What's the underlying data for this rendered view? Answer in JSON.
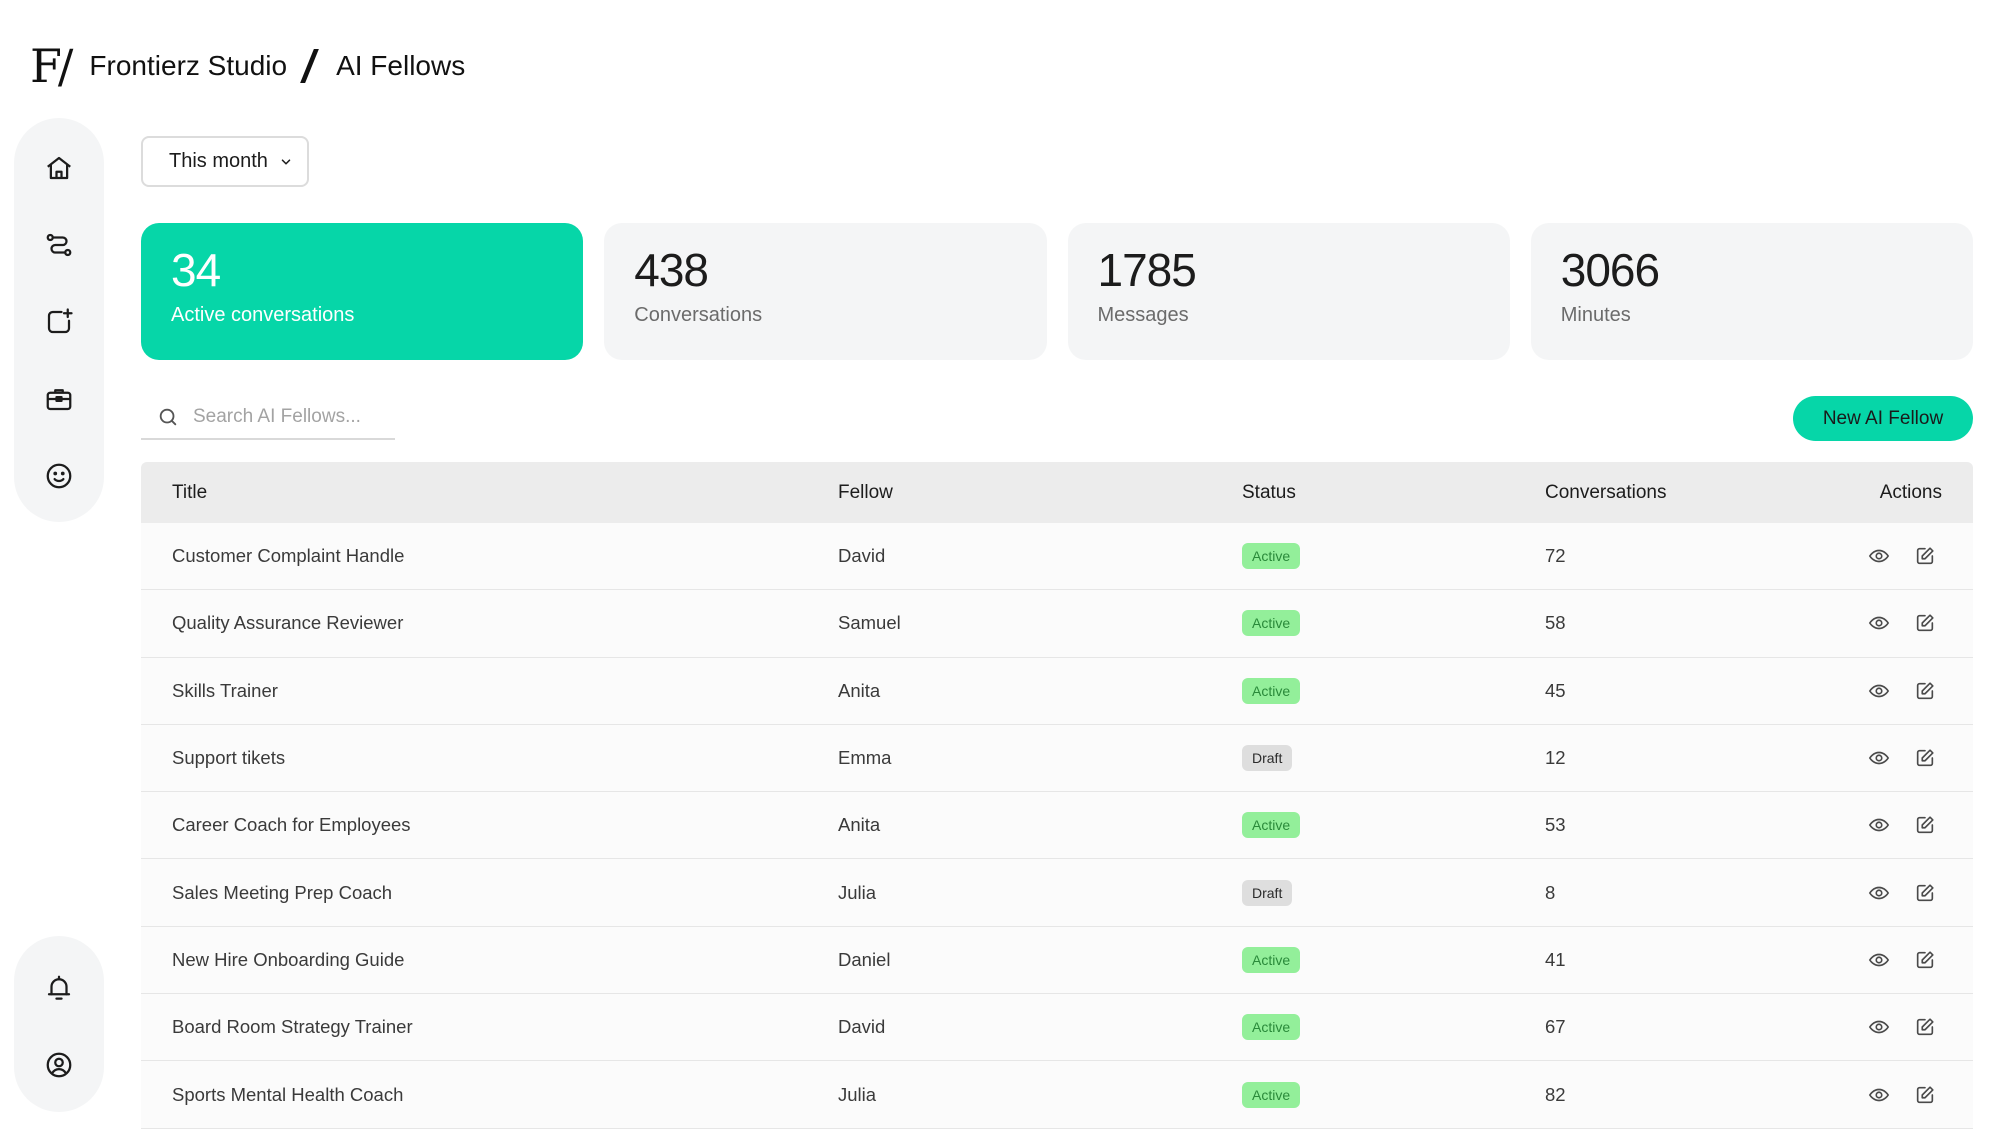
{
  "brand": {
    "logo_text": "F/",
    "workspace": "Frontierz Studio",
    "section": "AI Fellows"
  },
  "sidebar": {
    "top": [
      {
        "icon": "home-icon"
      },
      {
        "icon": "route-icon"
      },
      {
        "icon": "add-square-icon"
      },
      {
        "icon": "briefcase-icon"
      },
      {
        "icon": "smiley-icon"
      }
    ],
    "bottom": [
      {
        "icon": "bell-icon"
      },
      {
        "icon": "user-circle-icon"
      }
    ]
  },
  "filters": {
    "period": "This month"
  },
  "stats": [
    {
      "value": "34",
      "label": "Active conversations"
    },
    {
      "value": "438",
      "label": "Conversations"
    },
    {
      "value": "1785",
      "label": "Messages"
    },
    {
      "value": "3066",
      "label": "Minutes"
    }
  ],
  "search": {
    "placeholder": "Search AI Fellows..."
  },
  "new_button": "New AI Fellow",
  "table": {
    "columns": [
      "Title",
      "Fellow",
      "Status",
      "Conversations",
      "Actions"
    ],
    "rows": [
      {
        "title": "Customer Complaint Handle",
        "fellow": "David",
        "status": "Active",
        "conversations": "72"
      },
      {
        "title": "Quality Assurance Reviewer",
        "fellow": "Samuel",
        "status": "Active",
        "conversations": "58"
      },
      {
        "title": "Skills Trainer",
        "fellow": "Anita",
        "status": "Active",
        "conversations": "45"
      },
      {
        "title": "Support tikets",
        "fellow": "Emma",
        "status": "Draft",
        "conversations": "12"
      },
      {
        "title": "Career Coach for Employees",
        "fellow": "Anita",
        "status": "Active",
        "conversations": "53"
      },
      {
        "title": "Sales Meeting Prep Coach",
        "fellow": "Julia",
        "status": "Draft",
        "conversations": "8"
      },
      {
        "title": "New Hire Onboarding Guide",
        "fellow": "Daniel",
        "status": "Active",
        "conversations": "41"
      },
      {
        "title": "Board Room Strategy Trainer",
        "fellow": "David",
        "status": "Active",
        "conversations": "67"
      },
      {
        "title": "Sports Mental Health Coach",
        "fellow": "Julia",
        "status": "Active",
        "conversations": "82"
      }
    ]
  },
  "colors": {
    "accent": "#06d6a8",
    "active_badge": "#93ef9a",
    "draft_badge": "#dedede"
  }
}
